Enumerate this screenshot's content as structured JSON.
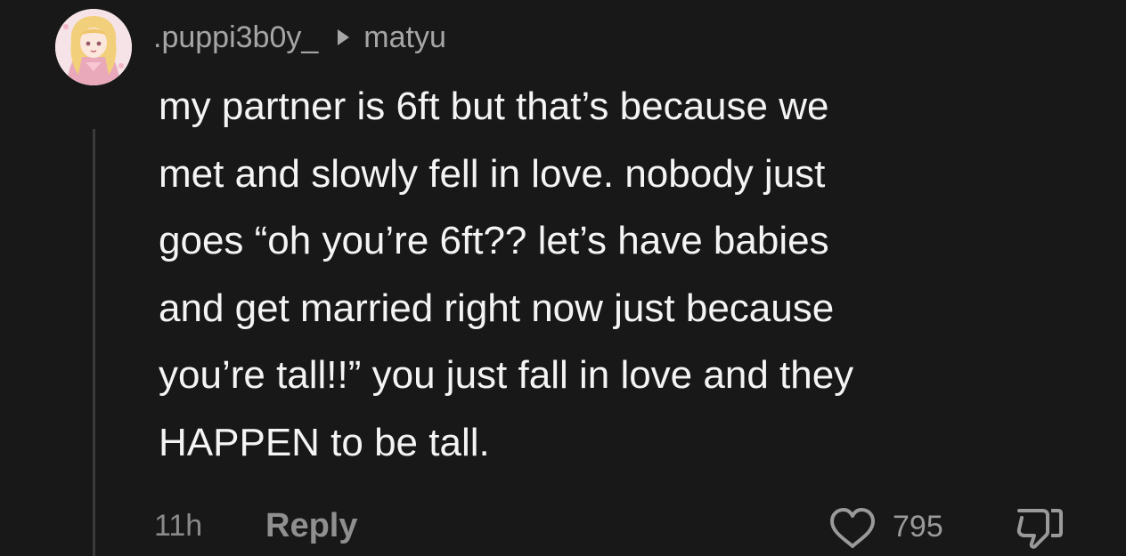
{
  "comment": {
    "username": ".puppi3b0y_",
    "reply_to": "matyu",
    "lines": [
      "my partner is 6ft but that’s because we",
      "met and slowly fell in love. nobody just",
      "goes “oh you’re 6ft?? let’s have babies",
      "and get married right now just because",
      "you’re tall!!” you just fall in love and they",
      "HAPPEN to be tall."
    ],
    "time_ago": "11h",
    "reply_label": "Reply",
    "like_count": "795"
  },
  "icons": {
    "avatar": "avatar-image",
    "reply_arrow": "reply-arrow-icon",
    "like": "heart-outline-icon",
    "dislike": "thumbs-down-icon"
  },
  "colors": {
    "background": "#181818",
    "text": "#f4f4f4",
    "muted": "#a6a6a6"
  }
}
